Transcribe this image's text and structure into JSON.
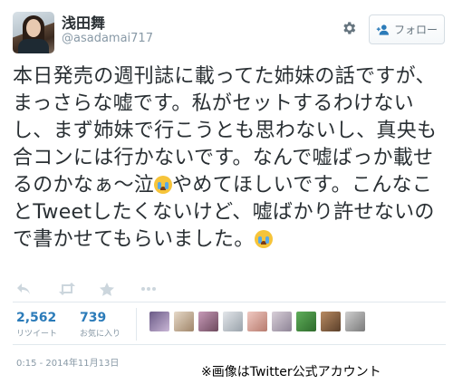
{
  "user": {
    "name": "浅田舞",
    "handle": "@asadamai717"
  },
  "follow_button": {
    "label": "フォロー"
  },
  "tweet": {
    "text_1": "本日発売の週刊誌に載ってた姉妹の話ですが、まっさらな嘘です。私がセットするわけないし、まず姉妹で行こうとも思わないし、真央も合コンには行かないです。なんで嘘ばっか載せるのかなぁ～泣",
    "text_2": "やめてほしいです。こんなことTweetしたくないけど、嘘ばかり許せないので書かせてもらいました。",
    "emoji_name": "crying-face-icon"
  },
  "stats": {
    "retweets": {
      "count": "2,562",
      "label": "リツイート"
    },
    "favorites": {
      "count": "739",
      "label": "お気に入り"
    }
  },
  "timestamp": "0:15 - 2014年11月13日",
  "credit": "※画像はTwitter公式アカウント",
  "colors": {
    "link": "#2b7bb9",
    "muted": "#8899a6",
    "text": "#292f33"
  }
}
